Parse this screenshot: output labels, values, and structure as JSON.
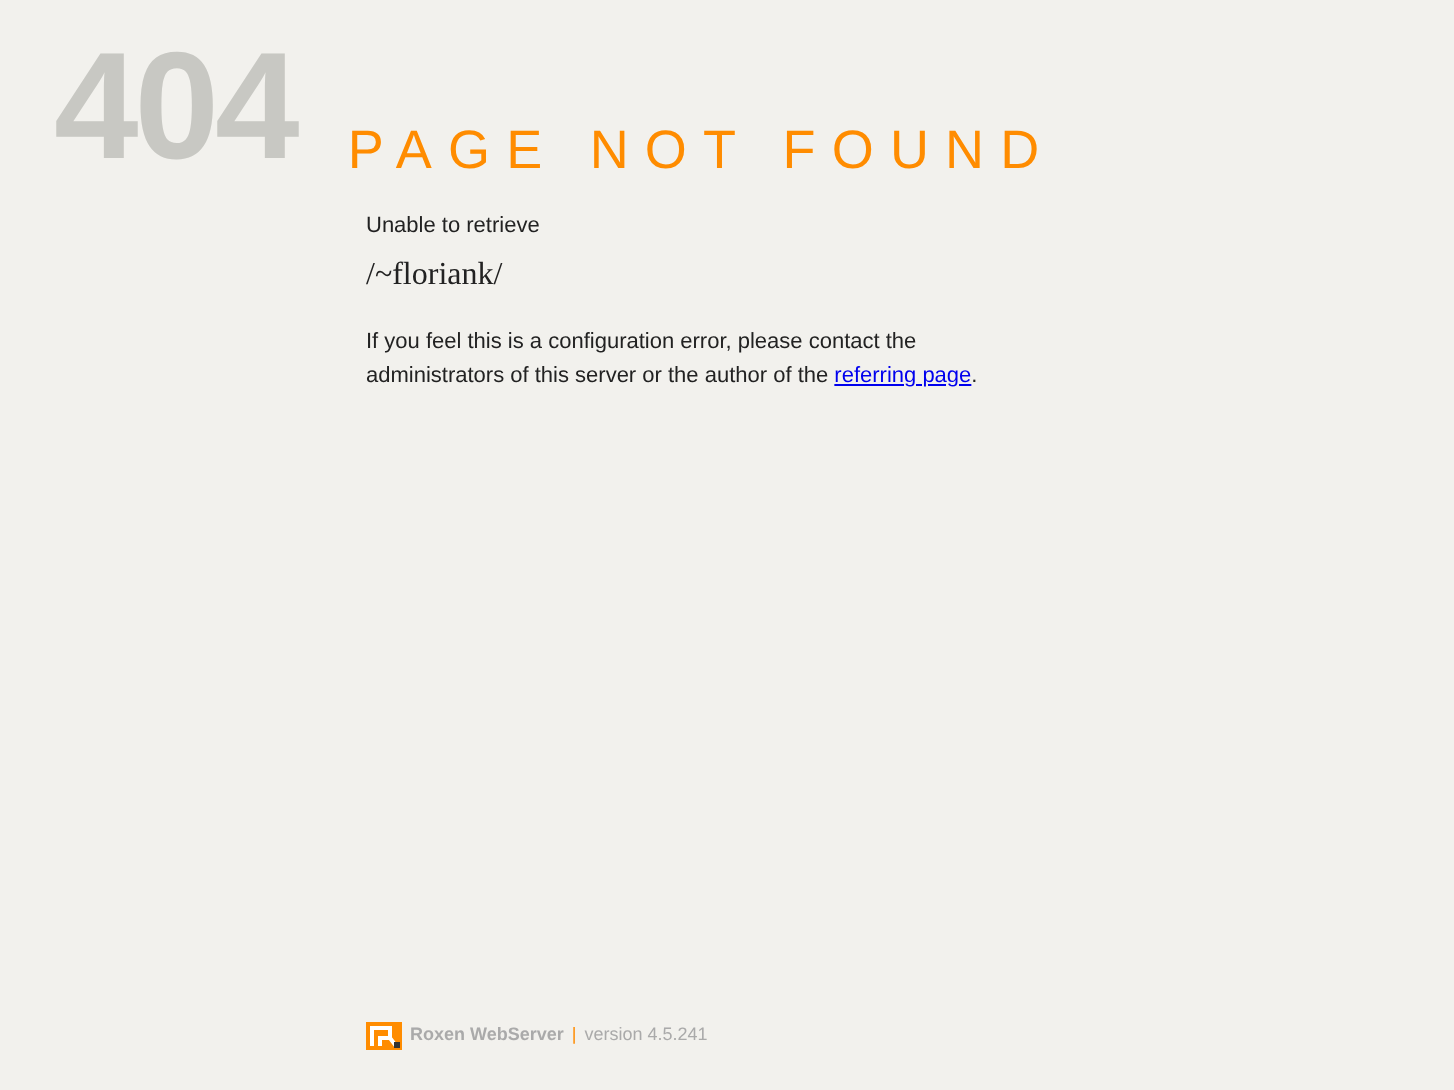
{
  "code": "404",
  "title": "PAGE NOT FOUND",
  "intro": "Unable to retrieve",
  "path": "/~floriank/",
  "message": {
    "before": "If you feel this is a configuration error, please contact the administrators of this server or the author of the",
    "link": "referring page",
    "after": "."
  },
  "footer": {
    "product": "Roxen WebServer",
    "separator": "|",
    "version": "version 4.5.241"
  }
}
